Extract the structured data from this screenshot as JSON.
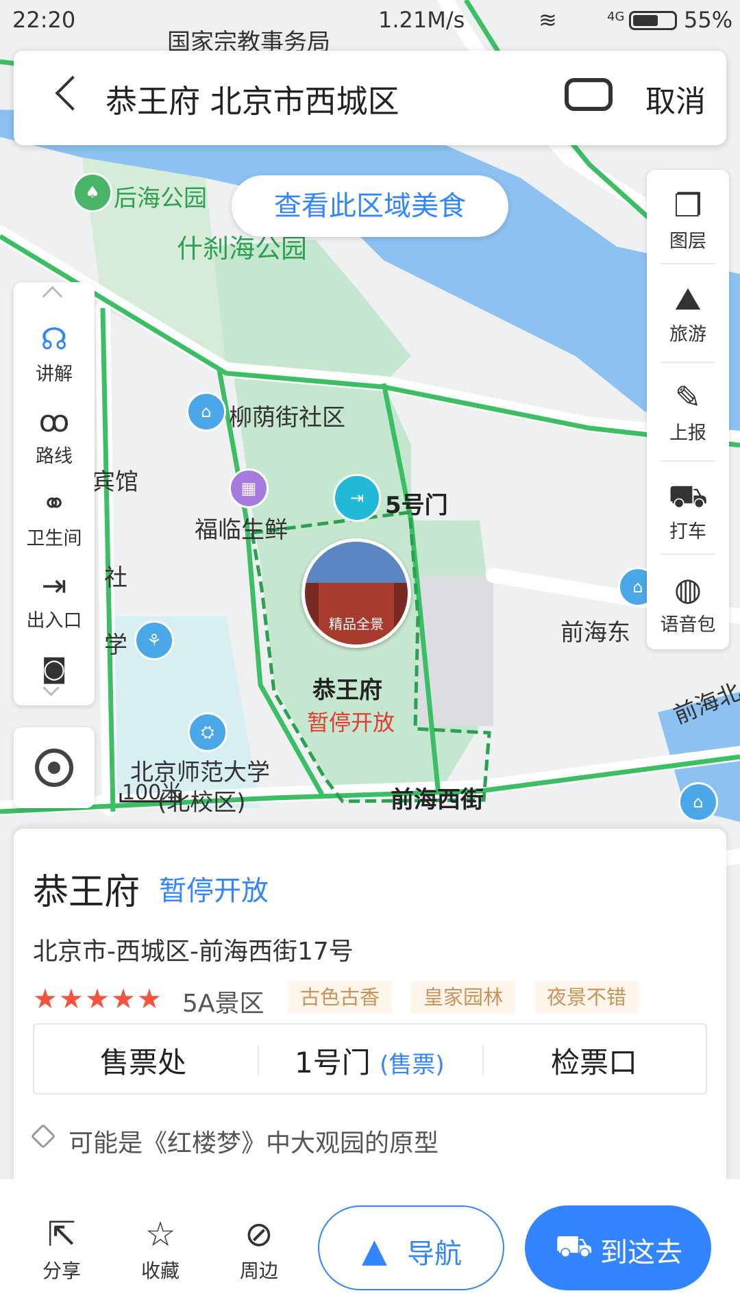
{
  "status_bar": {
    "time": "22:20",
    "speed": "1.21M/s",
    "network": "4G",
    "battery": "55%"
  },
  "search": {
    "query": "恭王府 北京市西城区",
    "cancel": "取消"
  },
  "food_button": "查看此区域美食",
  "map_labels": {
    "guojia": "国家宗教事务局",
    "houhai_park": "后海公园",
    "shichahai_park": "什刹海公园",
    "liuyinjie": "柳荫街社区",
    "fulin": "福临生鲜",
    "gate5": "5号门",
    "poi_name": "恭王府",
    "poi_status": "暂停开放",
    "bnu": "北京师范大学",
    "bnu_sub": "(北校区)",
    "qianhai_west": "前海西街",
    "qianhai_east": "前海东",
    "qianhai_north": "前海北",
    "hotel": "宾馆",
    "she": "社",
    "xue": "学",
    "panorama": "精品全景",
    "scale": "100米"
  },
  "left_tools": [
    {
      "label": "讲解",
      "icon": "headphones-icon"
    },
    {
      "label": "路线",
      "icon": "route-icon"
    },
    {
      "label": "卫生间",
      "icon": "restroom-icon"
    },
    {
      "label": "出入口",
      "icon": "exit-icon"
    }
  ],
  "right_tools": [
    {
      "label": "图层",
      "icon": "layers-icon"
    },
    {
      "label": "旅游",
      "icon": "travel-icon"
    },
    {
      "label": "上报",
      "icon": "report-icon"
    },
    {
      "label": "打车",
      "icon": "taxi-icon"
    },
    {
      "label": "语音包",
      "icon": "voice-pack-icon"
    }
  ],
  "card": {
    "title": "恭王府",
    "status": "暂停开放",
    "address": "北京市-西城区-前海西街17号",
    "rating_stars": 5,
    "level": "5A景区",
    "tags": [
      "古色古香",
      "皇家园林",
      "夜景不错"
    ],
    "ticket_office": "售票处",
    "gate1": "1号门",
    "gate1_note": "(售票)",
    "check_in": "检票口",
    "tip": "可能是《红楼梦》中大观园的原型"
  },
  "actions": {
    "share": "分享",
    "favorite": "收藏",
    "nearby": "周边",
    "navigate": "导航",
    "go_here": "到这去"
  },
  "colors": {
    "accent": "#3385ff",
    "park": "#c6e7cf",
    "water": "#8cc1f2",
    "road": "#ffffff",
    "green_road": "#3cbf64"
  }
}
